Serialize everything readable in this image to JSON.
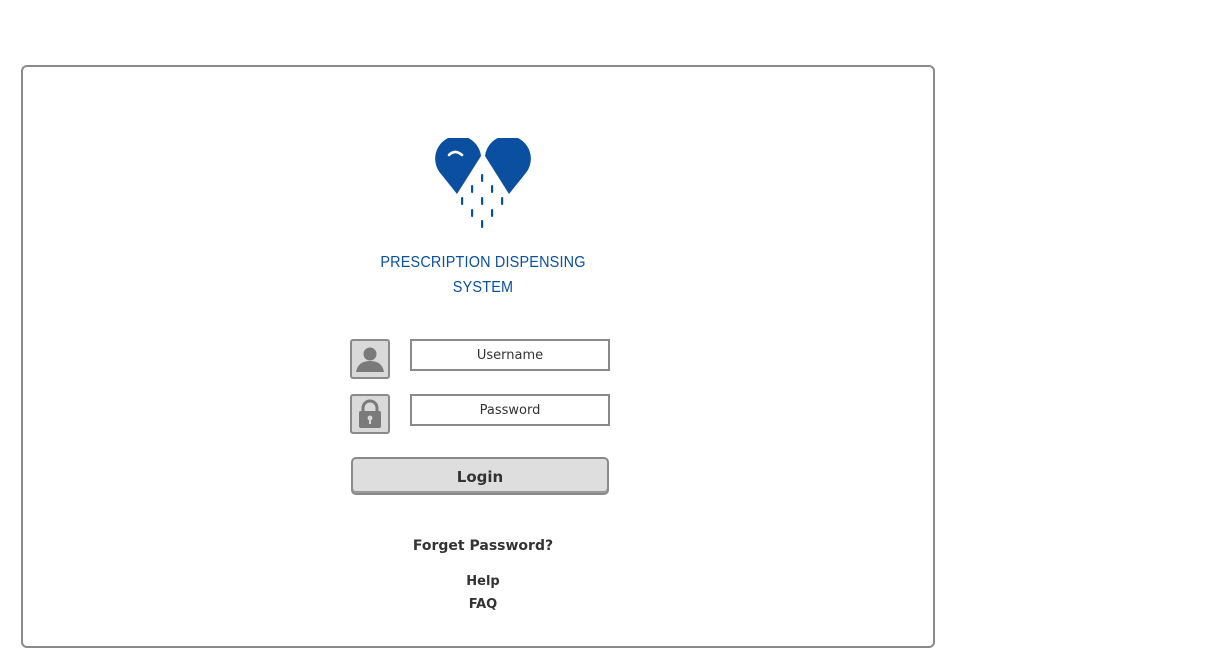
{
  "app": {
    "title_line1": "PRESCRIPTION DISPENSING",
    "title_line2": "SYSTEM",
    "brand_color": "#0b4fa0",
    "logo_icon": "heart-pill-icon"
  },
  "form": {
    "username": {
      "placeholder": "Username",
      "value": "",
      "icon": "user-icon"
    },
    "password": {
      "placeholder": "Password",
      "value": "",
      "icon": "lock-icon"
    },
    "login_label": "Login"
  },
  "links": {
    "forgot_password": "Forget Password?",
    "help": "Help",
    "faq": "FAQ"
  }
}
